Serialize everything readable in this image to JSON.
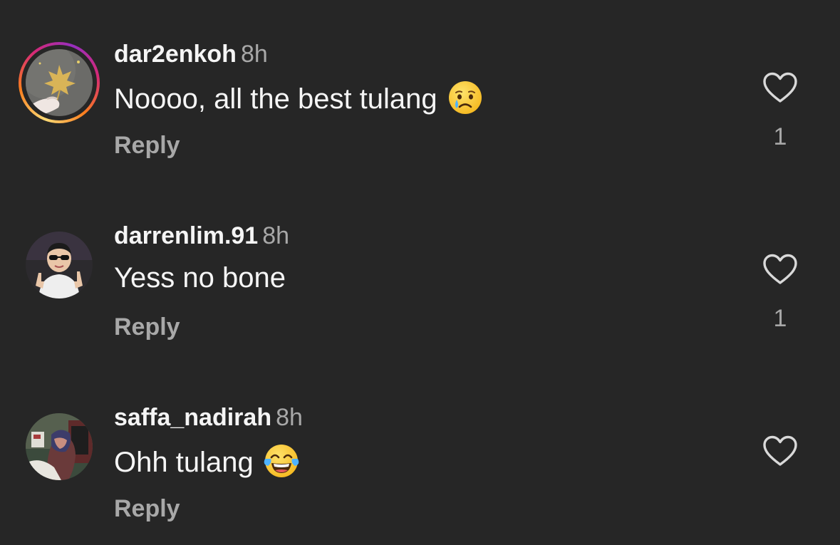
{
  "comments": [
    {
      "username": "dar2enkoh",
      "time": "8h",
      "text": "Noooo, all the best tulang",
      "emoji": "crying-face",
      "reply_label": "Reply",
      "likes": "1",
      "has_story_ring": true
    },
    {
      "username": "darrenlim.91",
      "time": "8h",
      "text": "Yess no bone",
      "emoji": "",
      "reply_label": "Reply",
      "likes": "1",
      "has_story_ring": false
    },
    {
      "username": "saffa_nadirah",
      "time": "8h",
      "text": "Ohh tulang",
      "emoji": "face-with-tears-of-joy",
      "reply_label": "Reply",
      "likes": "",
      "has_story_ring": false
    }
  ],
  "colors": {
    "background": "#262626",
    "primary_text": "#f5f5f5",
    "secondary_text": "#a8a8a8",
    "story_ring_start": "#feda75",
    "story_ring_mid": "#d62976",
    "story_ring_end": "#962fbf"
  }
}
